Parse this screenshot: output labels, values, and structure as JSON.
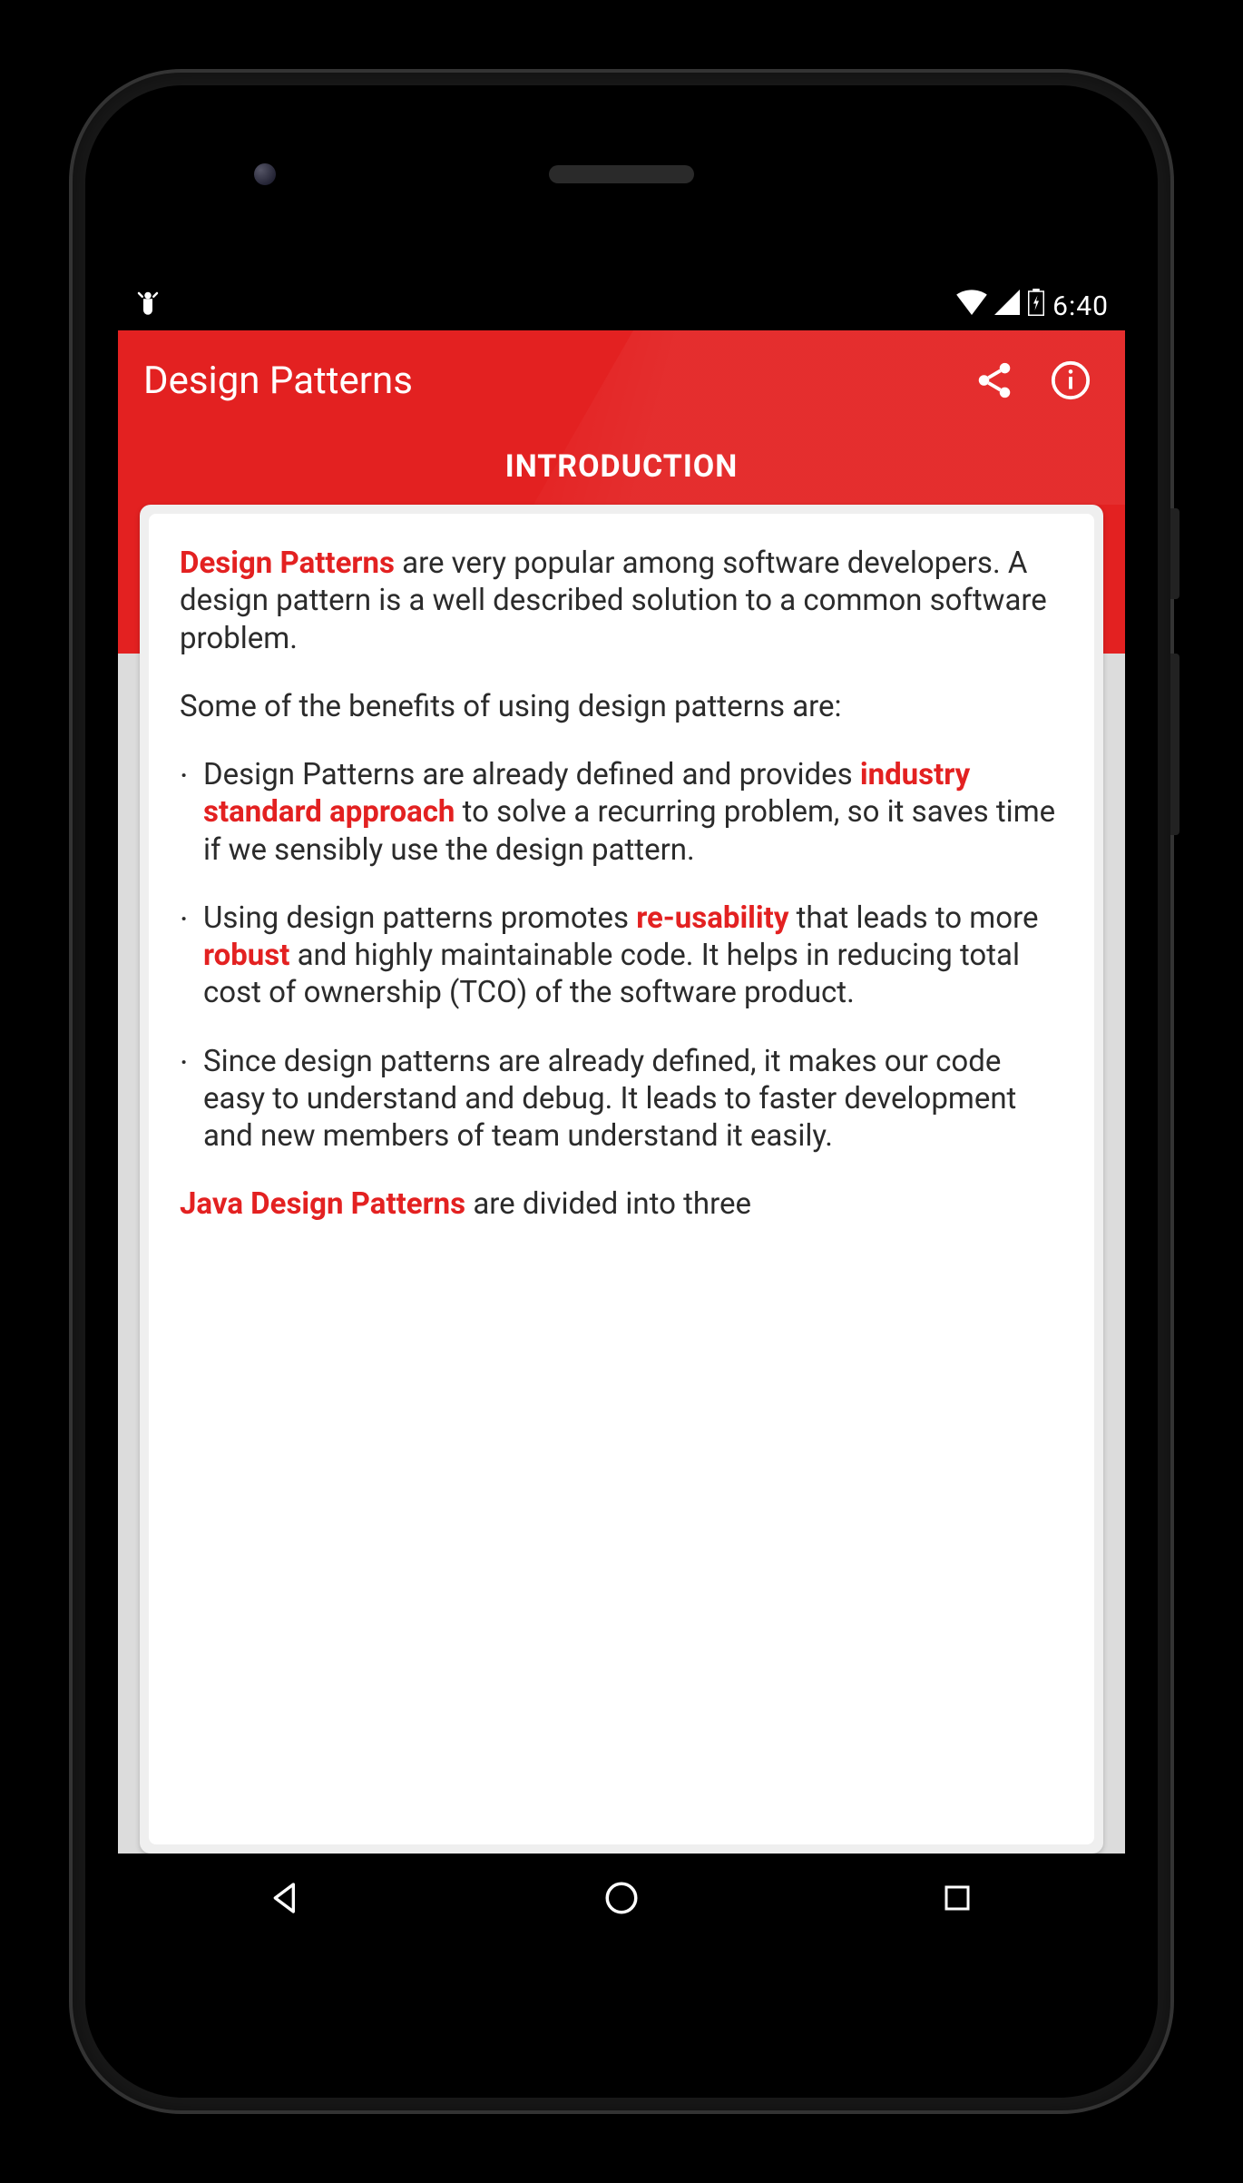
{
  "status": {
    "time": "6:40"
  },
  "appbar": {
    "title": "Design Patterns"
  },
  "subheader": {
    "label": "INTRODUCTION"
  },
  "content": {
    "intro_lead": "Design Patterns",
    "intro_rest": " are very popular among software developers. A design pattern is a well described solution to a common software problem.",
    "benefits_heading": "Some of the benefits of using design patterns are:",
    "b1_a": "Design Patterns are already defined and provides ",
    "b1_hl": "industry standard approach",
    "b1_b": " to solve a recurring problem, so it saves time if we sensibly use the design pattern.",
    "b2_a": "Using design patterns promotes ",
    "b2_hl1": "re-usability",
    "b2_b": " that leads to more ",
    "b2_hl2": "robust",
    "b2_c": " and highly maintainable code. It helps in reducing total cost of ownership (TCO) of the software product.",
    "b3": "Since design patterns are already defined, it makes our code easy to understand and debug. It leads to faster development and new members of team understand it easily.",
    "outro_lead": "Java Design Patterns",
    "outro_rest": " are divided into three"
  }
}
